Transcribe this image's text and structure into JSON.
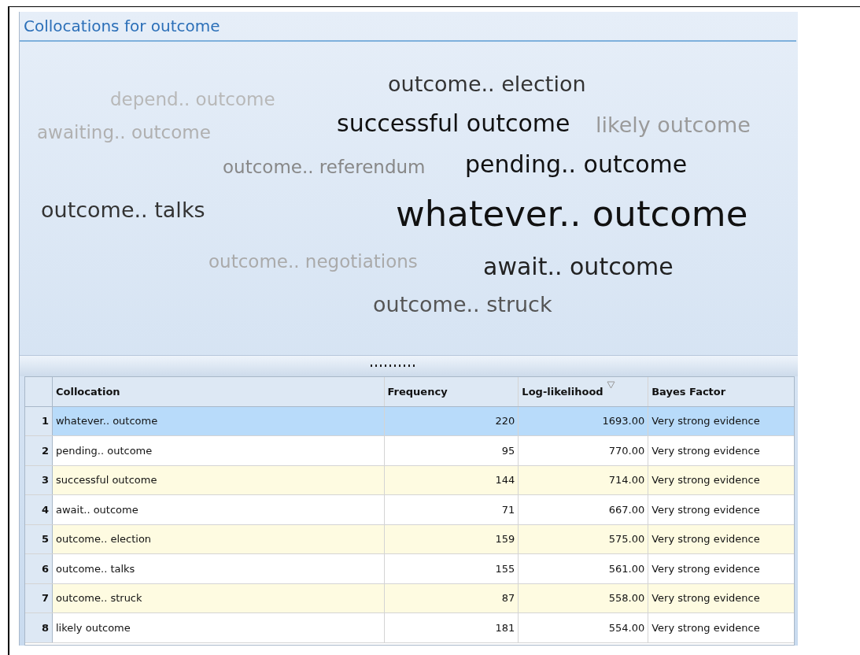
{
  "panel": {
    "title": "Collocations for outcome"
  },
  "cloud": [
    {
      "text": "outcome.. election",
      "kind": "l",
      "color": "#333333"
    },
    {
      "text": "depend.. outcome",
      "kind": "s",
      "color": "#b8b8b8"
    },
    {
      "text": "awaiting.. outcome",
      "kind": "s",
      "color": "#b0b0b0"
    },
    {
      "text": "successful outcome",
      "kind": "xl",
      "color": "#111111"
    },
    {
      "text": "likely outcome",
      "kind": "l",
      "color": "#9a9a9a"
    },
    {
      "text": "outcome.. referendum",
      "kind": "s",
      "color": "#888888"
    },
    {
      "text": "pending.. outcome",
      "kind": "xl",
      "color": "#111111"
    },
    {
      "text": "outcome.. talks",
      "kind": "l",
      "color": "#333333"
    },
    {
      "text": "whatever.. outcome",
      "kind": "xxl",
      "color": "#111111"
    },
    {
      "text": "outcome.. negotiations",
      "kind": "s",
      "color": "#aaaaaa"
    },
    {
      "text": "await.. outcome",
      "kind": "xl",
      "color": "#222222"
    },
    {
      "text": "outcome.. struck",
      "kind": "l",
      "color": "#555555"
    }
  ],
  "table": {
    "columns": [
      {
        "label": "Collocation",
        "sorted": false
      },
      {
        "label": "Frequency",
        "sorted": false
      },
      {
        "label": "Log-likelihood",
        "sorted": true
      },
      {
        "label": "Bayes Factor",
        "sorted": false
      }
    ],
    "rows": [
      {
        "index": "1",
        "cells": [
          "whatever.. outcome",
          "220",
          "1693.00",
          "Very strong evidence"
        ],
        "selected": true
      },
      {
        "index": "2",
        "cells": [
          "pending.. outcome",
          "95",
          "770.00",
          "Very strong evidence"
        ],
        "selected": false
      },
      {
        "index": "3",
        "cells": [
          "successful outcome",
          "144",
          "714.00",
          "Very strong evidence"
        ],
        "selected": false
      },
      {
        "index": "4",
        "cells": [
          "await.. outcome",
          "71",
          "667.00",
          "Very strong evidence"
        ],
        "selected": false
      },
      {
        "index": "5",
        "cells": [
          "outcome.. election",
          "159",
          "575.00",
          "Very strong evidence"
        ],
        "selected": false
      },
      {
        "index": "6",
        "cells": [
          "outcome.. talks",
          "155",
          "561.00",
          "Very strong evidence"
        ],
        "selected": false
      },
      {
        "index": "7",
        "cells": [
          "outcome.. struck",
          "87",
          "558.00",
          "Very strong evidence"
        ],
        "selected": false
      },
      {
        "index": "8",
        "cells": [
          "likely outcome",
          "181",
          "554.00",
          "Very strong evidence"
        ],
        "selected": false
      }
    ]
  }
}
